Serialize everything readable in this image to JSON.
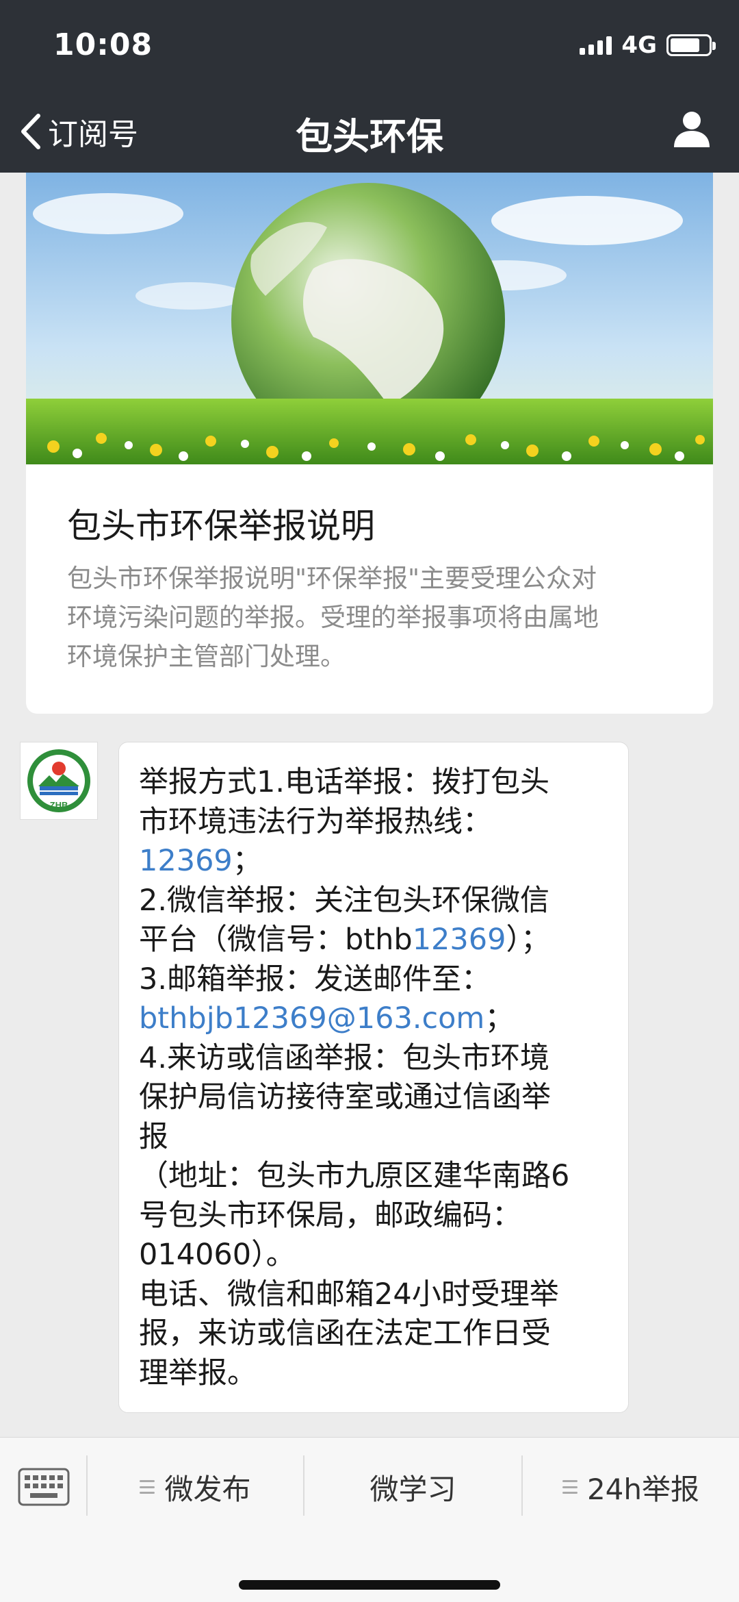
{
  "status": {
    "time": "10:08",
    "network": "4G"
  },
  "nav": {
    "back_label": "订阅号",
    "title": "包头环保"
  },
  "article": {
    "title": "包头市环保举报说明",
    "description_lines": [
      "包头市环保举报说明\"环保举报\"主要受理公众对",
      "环境污染问题的举报。受理的举报事项将由属地",
      "环境保护主管部门处理。"
    ]
  },
  "account": {
    "avatar_text": "ZHB"
  },
  "message": {
    "l1": "举报方式1.电话举报：拨打包头",
    "l2": "市环境违法行为举报热线：",
    "l3_link": "12369",
    "l3_tail": "；",
    "l4": "2.微信举报：关注包头环保微信",
    "l5_head": "平台（微信号：bthb",
    "l5_link": "12369",
    "l5_tail": "）；",
    "l6": "3.邮箱举报：发送邮件至：",
    "l7_link": "bthbjb12369@163.com",
    "l7_tail": "；",
    "l8": "4.来访或信函举报：包头市环境",
    "l9": "保护局信访接待室或通过信函举",
    "l10": "报",
    "l11": "（地址：包头市九原区建华南路6",
    "l12": "号包头市环保局，邮政编码：",
    "l13": "014060）。",
    "l14": "电话、微信和邮箱24小时受理举",
    "l15": "报，来访或信函在法定工作日受",
    "l16": "理举报。"
  },
  "menu": {
    "items": [
      "微发布",
      "微学习",
      "24h举报"
    ]
  },
  "colors": {
    "header_bg": "#2d3137",
    "link": "#3d7ec9",
    "page_bg": "#ececec"
  },
  "icons": [
    "signal-icon",
    "battery-icon",
    "back-chevron-icon",
    "user-profile-icon",
    "keyboard-icon",
    "menu-list-icon"
  ]
}
